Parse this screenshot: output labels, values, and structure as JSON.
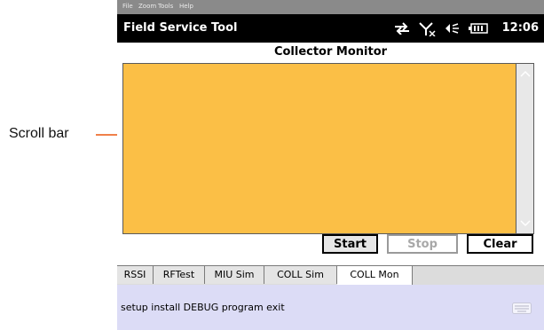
{
  "callout": {
    "label": "Scroll bar"
  },
  "menu": {
    "items": [
      "File",
      "Zoom",
      "Tools",
      "Help"
    ]
  },
  "titlebar": {
    "app_title": "Field Service Tool",
    "clock": "12:06",
    "status_icons": [
      "sync-arrows-icon",
      "signal-off-icon",
      "speaker-icon",
      "battery-icon"
    ]
  },
  "panel": {
    "title": "Collector Monitor"
  },
  "buttons": {
    "start": "Start",
    "stop": "Stop",
    "clear": "Clear"
  },
  "tabs": [
    {
      "label": "RSSI",
      "active": false
    },
    {
      "label": "RFTest",
      "active": false
    },
    {
      "label": "MIU Sim",
      "active": false
    },
    {
      "label": "COLL Sim",
      "active": false
    },
    {
      "label": "COLL Mon",
      "active": true
    }
  ],
  "bottombar": {
    "commands": "setup install DEBUG program exit",
    "keyboard_icon": "keyboard-icon"
  },
  "colors": {
    "monitor_bg": "#fbbf46",
    "callout": "#f0804a",
    "titlebar_bg": "#000000",
    "bottombar_bg": "#dcdcf6"
  }
}
